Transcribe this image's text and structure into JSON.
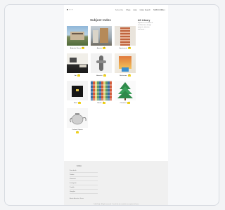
{
  "nav": {
    "logo": "▾ · · ·",
    "links": [
      "Subscribe",
      "Shop",
      "Lists",
      "Index Search"
    ],
    "menu": "SUBSCRIBE",
    "menu_caret": "▾"
  },
  "page": {
    "title": "Subject Index"
  },
  "sidebar": {
    "title": "AD Library",
    "text": [
      "Explore our archive of",
      "architecture, design",
      "projects, interiors",
      "and more..."
    ]
  },
  "grid": [
    {
      "label": "Adaptive Reuse",
      "count": "12",
      "icon": "building-photo"
    },
    {
      "label": "Airports",
      "count": "8",
      "icon": "airport-photo"
    },
    {
      "label": "Apartments",
      "count": "30",
      "icon": "apartment-photo"
    },
    {
      "label": "Art",
      "count": "5",
      "icon": "art-room-photo"
    },
    {
      "label": "Artworks",
      "count": "6",
      "icon": "sculpture-photo"
    },
    {
      "label": "Bathrooms",
      "count": "11",
      "icon": "bathroom-photo"
    },
    {
      "label": "Book",
      "count": "4",
      "icon": "book-photo"
    },
    {
      "label": "Books",
      "count": "9",
      "icon": "books-grid-photo"
    },
    {
      "label": "Christmas",
      "count": "3",
      "icon": "christmas-tree-photo"
    }
  ],
  "single": {
    "label": "Cultural Objects",
    "count": "2",
    "icon": "teapot-photo"
  },
  "footer": {
    "heading": "Follow",
    "links": [
      "Facebook",
      "Twitter",
      "Pinterest",
      "Instagram",
      "Tumblr",
      "Google+"
    ],
    "bottom": "About   Advertise   Terms",
    "copyright": "© ArchDaily · All rights reserved · Use of this site constitutes acceptance of terms"
  },
  "colors": {
    "badge": "#f1d21a"
  }
}
